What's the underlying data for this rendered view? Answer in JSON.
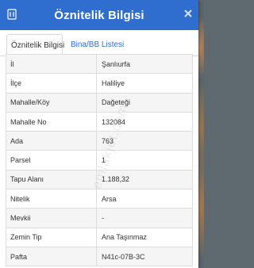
{
  "dialog": {
    "title": "Öznitelik Bilgisi",
    "close_icon": "close-icon",
    "title_icon": "info-icon",
    "accent_color": "#2f6ecf"
  },
  "tabs": [
    {
      "label": "Öznitelik Bilgisi",
      "active": true
    },
    {
      "label": "Bina/BB Listesi",
      "active": false
    }
  ],
  "attributes": [
    {
      "key": "İl",
      "value": "Şanlıurfa"
    },
    {
      "key": "İlçe",
      "value": "Haliliye"
    },
    {
      "key": "Mahalle/Köy",
      "value": "Dağeteği"
    },
    {
      "key": "Mahalle No",
      "value": "132084"
    },
    {
      "key": "Ada",
      "value": "763"
    },
    {
      "key": "Parsel",
      "value": "1"
    },
    {
      "key": "Tapu Alanı",
      "value": "1.188,32"
    },
    {
      "key": "Nitelik",
      "value": "Arsa"
    },
    {
      "key": "Mevkii",
      "value": "-"
    },
    {
      "key": "Zemin Tip",
      "value": "Ana Taşınmaz"
    },
    {
      "key": "Pafta",
      "value": "N41c-07B-3C"
    }
  ],
  "watermark": "emlakjet.com"
}
